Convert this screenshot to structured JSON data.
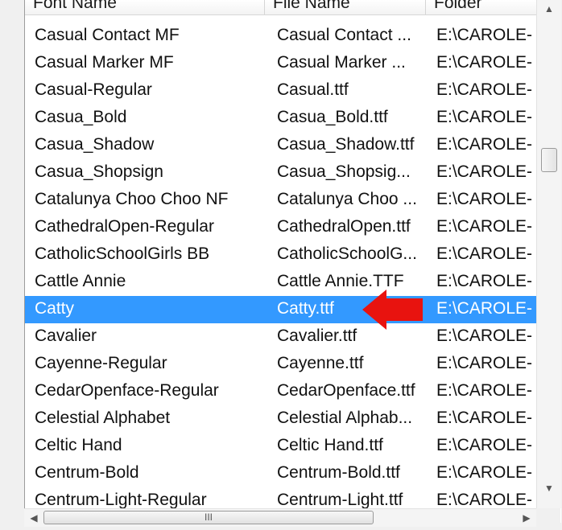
{
  "columns": {
    "font_name": "Font Name",
    "file_name": "File Name",
    "folder": "Folder"
  },
  "rows": [
    {
      "font": "Casual Contact MF",
      "file": "Casual Contact ...",
      "folder": "E:\\CAROLE-"
    },
    {
      "font": "Casual Marker MF",
      "file": "Casual Marker ...",
      "folder": "E:\\CAROLE-"
    },
    {
      "font": "Casual-Regular",
      "file": "Casual.ttf",
      "folder": "E:\\CAROLE-"
    },
    {
      "font": "Casua_Bold",
      "file": "Casua_Bold.ttf",
      "folder": "E:\\CAROLE-"
    },
    {
      "font": "Casua_Shadow",
      "file": "Casua_Shadow.ttf",
      "folder": "E:\\CAROLE-"
    },
    {
      "font": "Casua_Shopsign",
      "file": "Casua_Shopsig...",
      "folder": "E:\\CAROLE-"
    },
    {
      "font": "Catalunya Choo Choo NF",
      "file": "Catalunya Choo ...",
      "folder": "E:\\CAROLE-"
    },
    {
      "font": "CathedralOpen-Regular",
      "file": "CathedralOpen.ttf",
      "folder": "E:\\CAROLE-"
    },
    {
      "font": "CatholicSchoolGirls BB",
      "file": "CatholicSchoolG...",
      "folder": "E:\\CAROLE-"
    },
    {
      "font": "Cattle Annie",
      "file": "Cattle Annie.TTF",
      "folder": "E:\\CAROLE-"
    },
    {
      "font": "Catty",
      "file": "Catty.ttf",
      "folder": "E:\\CAROLE-",
      "selected": true
    },
    {
      "font": "Cavalier",
      "file": "Cavalier.ttf",
      "folder": "E:\\CAROLE-"
    },
    {
      "font": "Cayenne-Regular",
      "file": "Cayenne.ttf",
      "folder": "E:\\CAROLE-"
    },
    {
      "font": "CedarOpenface-Regular",
      "file": "CedarOpenface.ttf",
      "folder": "E:\\CAROLE-"
    },
    {
      "font": "Celestial Alphabet",
      "file": "Celestial Alphab...",
      "folder": "E:\\CAROLE-"
    },
    {
      "font": "Celtic Hand",
      "file": "Celtic Hand.ttf",
      "folder": "E:\\CAROLE-"
    },
    {
      "font": "Centrum-Bold",
      "file": "Centrum-Bold.ttf",
      "folder": "E:\\CAROLE-"
    },
    {
      "font": "Centrum-Light-Regular",
      "file": "Centrum-Light.ttf",
      "folder": "E:\\CAROLE-"
    }
  ],
  "colors": {
    "selection": "#3399ff",
    "arrow": "#e8130f"
  },
  "icons": {
    "scroll_up": "scroll-up-arrow-icon",
    "scroll_down": "scroll-down-arrow-icon",
    "scroll_left": "scroll-left-arrow-icon",
    "scroll_right": "scroll-right-arrow-icon",
    "thumb_grip": "III",
    "pointer": "red-arrow-icon"
  }
}
